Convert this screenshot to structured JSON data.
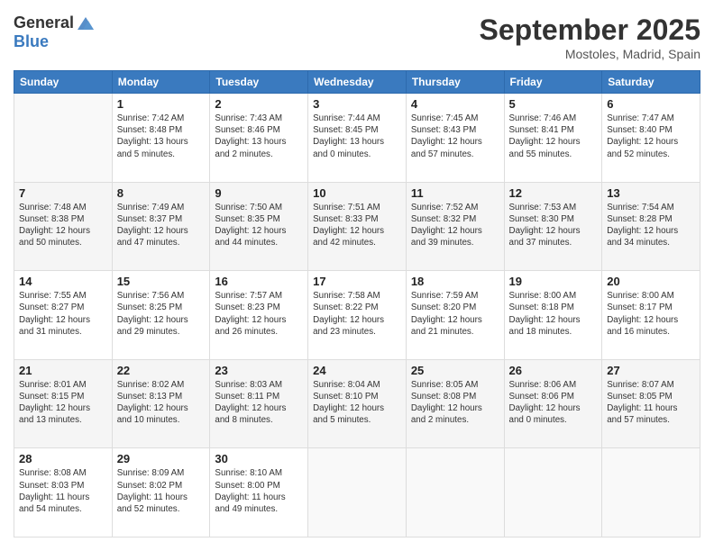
{
  "logo": {
    "general": "General",
    "blue": "Blue"
  },
  "title": "September 2025",
  "location": "Mostoles, Madrid, Spain",
  "headers": [
    "Sunday",
    "Monday",
    "Tuesday",
    "Wednesday",
    "Thursday",
    "Friday",
    "Saturday"
  ],
  "weeks": [
    [
      {
        "day": "",
        "info": ""
      },
      {
        "day": "1",
        "info": "Sunrise: 7:42 AM\nSunset: 8:48 PM\nDaylight: 13 hours\nand 5 minutes."
      },
      {
        "day": "2",
        "info": "Sunrise: 7:43 AM\nSunset: 8:46 PM\nDaylight: 13 hours\nand 2 minutes."
      },
      {
        "day": "3",
        "info": "Sunrise: 7:44 AM\nSunset: 8:45 PM\nDaylight: 13 hours\nand 0 minutes."
      },
      {
        "day": "4",
        "info": "Sunrise: 7:45 AM\nSunset: 8:43 PM\nDaylight: 12 hours\nand 57 minutes."
      },
      {
        "day": "5",
        "info": "Sunrise: 7:46 AM\nSunset: 8:41 PM\nDaylight: 12 hours\nand 55 minutes."
      },
      {
        "day": "6",
        "info": "Sunrise: 7:47 AM\nSunset: 8:40 PM\nDaylight: 12 hours\nand 52 minutes."
      }
    ],
    [
      {
        "day": "7",
        "info": "Sunrise: 7:48 AM\nSunset: 8:38 PM\nDaylight: 12 hours\nand 50 minutes."
      },
      {
        "day": "8",
        "info": "Sunrise: 7:49 AM\nSunset: 8:37 PM\nDaylight: 12 hours\nand 47 minutes."
      },
      {
        "day": "9",
        "info": "Sunrise: 7:50 AM\nSunset: 8:35 PM\nDaylight: 12 hours\nand 44 minutes."
      },
      {
        "day": "10",
        "info": "Sunrise: 7:51 AM\nSunset: 8:33 PM\nDaylight: 12 hours\nand 42 minutes."
      },
      {
        "day": "11",
        "info": "Sunrise: 7:52 AM\nSunset: 8:32 PM\nDaylight: 12 hours\nand 39 minutes."
      },
      {
        "day": "12",
        "info": "Sunrise: 7:53 AM\nSunset: 8:30 PM\nDaylight: 12 hours\nand 37 minutes."
      },
      {
        "day": "13",
        "info": "Sunrise: 7:54 AM\nSunset: 8:28 PM\nDaylight: 12 hours\nand 34 minutes."
      }
    ],
    [
      {
        "day": "14",
        "info": "Sunrise: 7:55 AM\nSunset: 8:27 PM\nDaylight: 12 hours\nand 31 minutes."
      },
      {
        "day": "15",
        "info": "Sunrise: 7:56 AM\nSunset: 8:25 PM\nDaylight: 12 hours\nand 29 minutes."
      },
      {
        "day": "16",
        "info": "Sunrise: 7:57 AM\nSunset: 8:23 PM\nDaylight: 12 hours\nand 26 minutes."
      },
      {
        "day": "17",
        "info": "Sunrise: 7:58 AM\nSunset: 8:22 PM\nDaylight: 12 hours\nand 23 minutes."
      },
      {
        "day": "18",
        "info": "Sunrise: 7:59 AM\nSunset: 8:20 PM\nDaylight: 12 hours\nand 21 minutes."
      },
      {
        "day": "19",
        "info": "Sunrise: 8:00 AM\nSunset: 8:18 PM\nDaylight: 12 hours\nand 18 minutes."
      },
      {
        "day": "20",
        "info": "Sunrise: 8:00 AM\nSunset: 8:17 PM\nDaylight: 12 hours\nand 16 minutes."
      }
    ],
    [
      {
        "day": "21",
        "info": "Sunrise: 8:01 AM\nSunset: 8:15 PM\nDaylight: 12 hours\nand 13 minutes."
      },
      {
        "day": "22",
        "info": "Sunrise: 8:02 AM\nSunset: 8:13 PM\nDaylight: 12 hours\nand 10 minutes."
      },
      {
        "day": "23",
        "info": "Sunrise: 8:03 AM\nSunset: 8:11 PM\nDaylight: 12 hours\nand 8 minutes."
      },
      {
        "day": "24",
        "info": "Sunrise: 8:04 AM\nSunset: 8:10 PM\nDaylight: 12 hours\nand 5 minutes."
      },
      {
        "day": "25",
        "info": "Sunrise: 8:05 AM\nSunset: 8:08 PM\nDaylight: 12 hours\nand 2 minutes."
      },
      {
        "day": "26",
        "info": "Sunrise: 8:06 AM\nSunset: 8:06 PM\nDaylight: 12 hours\nand 0 minutes."
      },
      {
        "day": "27",
        "info": "Sunrise: 8:07 AM\nSunset: 8:05 PM\nDaylight: 11 hours\nand 57 minutes."
      }
    ],
    [
      {
        "day": "28",
        "info": "Sunrise: 8:08 AM\nSunset: 8:03 PM\nDaylight: 11 hours\nand 54 minutes."
      },
      {
        "day": "29",
        "info": "Sunrise: 8:09 AM\nSunset: 8:02 PM\nDaylight: 11 hours\nand 52 minutes."
      },
      {
        "day": "30",
        "info": "Sunrise: 8:10 AM\nSunset: 8:00 PM\nDaylight: 11 hours\nand 49 minutes."
      },
      {
        "day": "",
        "info": ""
      },
      {
        "day": "",
        "info": ""
      },
      {
        "day": "",
        "info": ""
      },
      {
        "day": "",
        "info": ""
      }
    ]
  ]
}
